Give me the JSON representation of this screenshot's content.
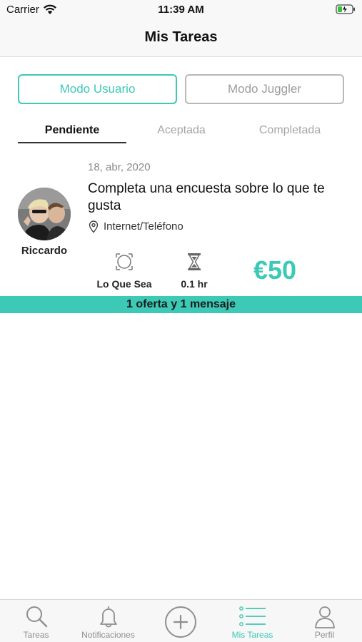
{
  "status_bar": {
    "carrier": "Carrier",
    "time": "11:39 AM"
  },
  "nav": {
    "title": "Mis Tareas"
  },
  "modes": {
    "user": "Modo Usuario",
    "juggler": "Modo Juggler",
    "active": "user"
  },
  "tabs": [
    {
      "label": "Pendiente",
      "active": true
    },
    {
      "label": "Aceptada",
      "active": false
    },
    {
      "label": "Completada",
      "active": false
    }
  ],
  "task": {
    "date": "18, abr, 2020",
    "title": "Completa una encuesta sobre lo que te gusta",
    "location": "Internet/Teléfono",
    "user_name": "Riccardo",
    "category_icon": "scope-icon",
    "category": "Lo Que Sea",
    "duration_icon": "hourglass-icon",
    "duration": "0.1 hr",
    "price": "€50",
    "offers": "1 oferta y 1 mensaje"
  },
  "tab_bar": [
    {
      "label": "Tareas",
      "icon": "search-icon",
      "active": false
    },
    {
      "label": "Notificaciones",
      "icon": "bell-icon",
      "active": false
    },
    {
      "label": "",
      "icon": "plus-circle-icon",
      "active": false
    },
    {
      "label": "Mis Tareas",
      "icon": "list-icon",
      "active": true
    },
    {
      "label": "Perfil",
      "icon": "person-icon",
      "active": false
    }
  ],
  "colors": {
    "accent": "#3cc9b6",
    "inactive": "#8e8e8e"
  }
}
